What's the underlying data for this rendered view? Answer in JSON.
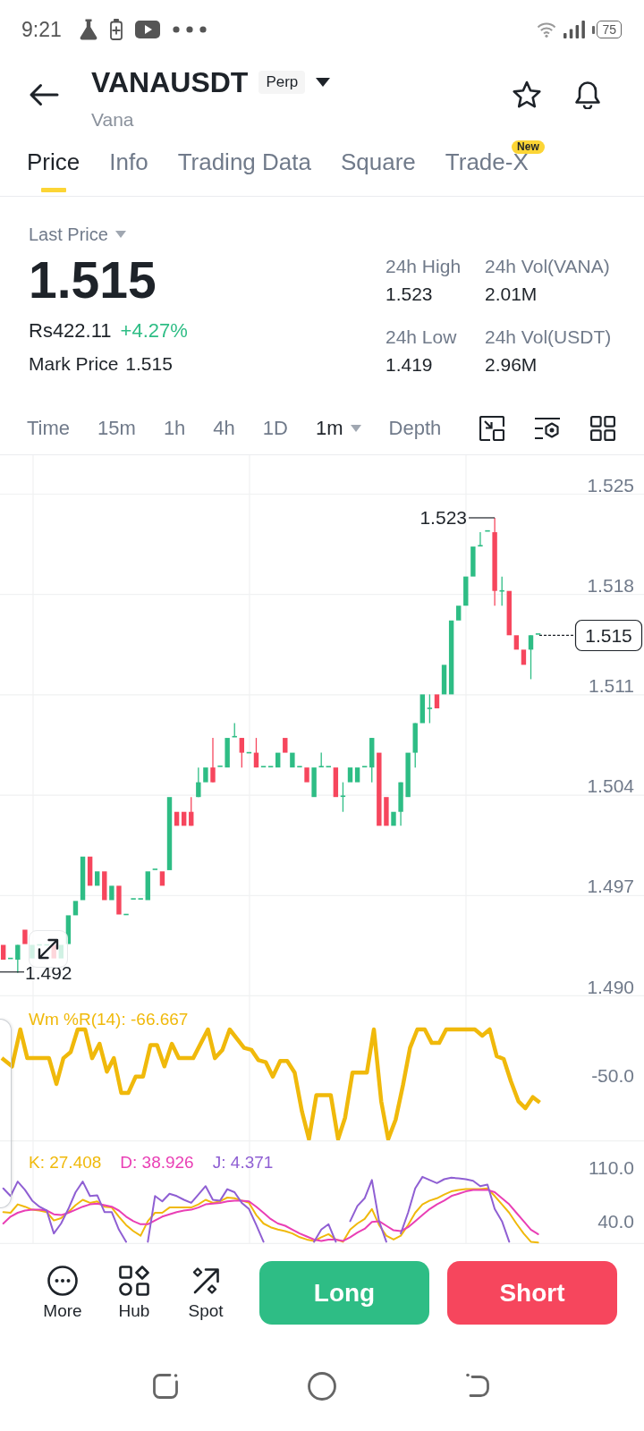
{
  "status_bar": {
    "time": "9:21",
    "battery": "75"
  },
  "header": {
    "symbol": "VANAUSDT",
    "contract_type": "Perp",
    "asset_name": "Vana"
  },
  "tabs": [
    {
      "label": "Price",
      "selected": true
    },
    {
      "label": "Info",
      "selected": false
    },
    {
      "label": "Trading Data",
      "selected": false
    },
    {
      "label": "Square",
      "selected": false
    },
    {
      "label": "Trade-X",
      "selected": false,
      "badge": "New"
    }
  ],
  "price_summary": {
    "price_type": "Last Price",
    "last_price": "1.515",
    "fiat_price": "Rs422.11",
    "change": "+4.27%",
    "mark_price_label": "Mark Price",
    "mark_price": "1.515",
    "stats": [
      {
        "label": "24h High",
        "value": "1.523"
      },
      {
        "label": "24h Vol(VANA)",
        "value": "2.01M"
      },
      {
        "label": "24h Low",
        "value": "1.419"
      },
      {
        "label": "24h Vol(USDT)",
        "value": "2.96M"
      }
    ]
  },
  "chart_toolbar": {
    "intervals": [
      {
        "label": "Time",
        "selected": false,
        "dropdown": false
      },
      {
        "label": "15m",
        "selected": false,
        "dropdown": false
      },
      {
        "label": "1h",
        "selected": false,
        "dropdown": false
      },
      {
        "label": "4h",
        "selected": false,
        "dropdown": false
      },
      {
        "label": "1D",
        "selected": false,
        "dropdown": false
      },
      {
        "label": "1m",
        "selected": true,
        "dropdown": true
      },
      {
        "label": "Depth",
        "selected": false,
        "dropdown": false
      }
    ]
  },
  "price_chart": {
    "price_axis": [
      "1.525",
      "1.518",
      "1.511",
      "1.504",
      "1.497",
      "1.490"
    ],
    "high_label": "1.523",
    "low_label": "1.492",
    "last_price_tag": "1.515"
  },
  "williams_r_panel": {
    "legend": "Wm %R(14): -66.667",
    "axis_label": "-50.0"
  },
  "kdj_panel": {
    "chart_data": {
      "type": "line",
      "grid": true,
      "ylim": [
        10,
        146
      ],
      "yticks": [
        {
          "value": 110,
          "label": "110.0"
        },
        {
          "value": 40,
          "label": "40.0"
        }
      ],
      "series": [
        {
          "name": "K: 27.408",
          "color": "#f0b90b",
          "values": [
            52,
            51,
            62,
            59,
            55,
            54,
            52,
            41,
            44,
            52,
            61,
            68,
            64,
            66,
            59,
            58,
            46,
            35,
            27,
            21,
            40,
            51,
            51,
            58,
            58,
            58,
            58,
            62,
            68,
            64,
            66,
            71,
            70,
            67,
            64,
            48,
            37,
            32,
            29,
            27,
            24,
            19,
            16,
            14,
            19,
            23,
            16,
            13,
            29,
            37,
            43,
            56,
            35,
            21,
            16,
            21,
            35,
            51,
            62,
            67,
            70,
            75,
            79,
            81,
            82,
            82,
            82,
            83,
            73,
            62,
            51,
            37,
            24,
            13,
            12
          ]
        },
        {
          "name": "D: 38.926",
          "color": "#e93fb5",
          "values": [
            37,
            46,
            51,
            54,
            55,
            55,
            54,
            49,
            48,
            51,
            55,
            59,
            62,
            63,
            61,
            59,
            54,
            46,
            40,
            36,
            36,
            41,
            46,
            49,
            52,
            54,
            55,
            58,
            62,
            63,
            64,
            66,
            67,
            67,
            66,
            59,
            51,
            43,
            37,
            34,
            29,
            24,
            20,
            16,
            14,
            16,
            16,
            14,
            19,
            25,
            30,
            39,
            40,
            34,
            28,
            27,
            32,
            40,
            48,
            56,
            62,
            67,
            73,
            76,
            79,
            81,
            81,
            81,
            78,
            70,
            62,
            51,
            40,
            29,
            23
          ]
        },
        {
          "name": "J: 4.371",
          "color": "#8f5fd3",
          "values": [
            83,
            73,
            92,
            81,
            67,
            59,
            54,
            24,
            37,
            56,
            78,
            92,
            73,
            74,
            52,
            52,
            29,
            13,
            null,
            null,
            13,
            73,
            66,
            76,
            73,
            68,
            64,
            75,
            86,
            68,
            67,
            82,
            78,
            64,
            56,
            35,
            13,
            null,
            null,
            null,
            null,
            null,
            null,
            13,
            29,
            36,
            13,
            null,
            40,
            60,
            70,
            94,
            40,
            13,
            null,
            24,
            51,
            83,
            98,
            94,
            90,
            95,
            97,
            96,
            95,
            93,
            86,
            88,
            56,
            40,
            13,
            null,
            null,
            null,
            null
          ]
        }
      ]
    }
  },
  "bottom_bar": {
    "shortcuts": [
      {
        "label": "More"
      },
      {
        "label": "Hub"
      },
      {
        "label": "Spot"
      }
    ],
    "trade_buttons": [
      {
        "label": "Long",
        "kind": "long"
      },
      {
        "label": "Short",
        "kind": "short"
      }
    ]
  }
}
